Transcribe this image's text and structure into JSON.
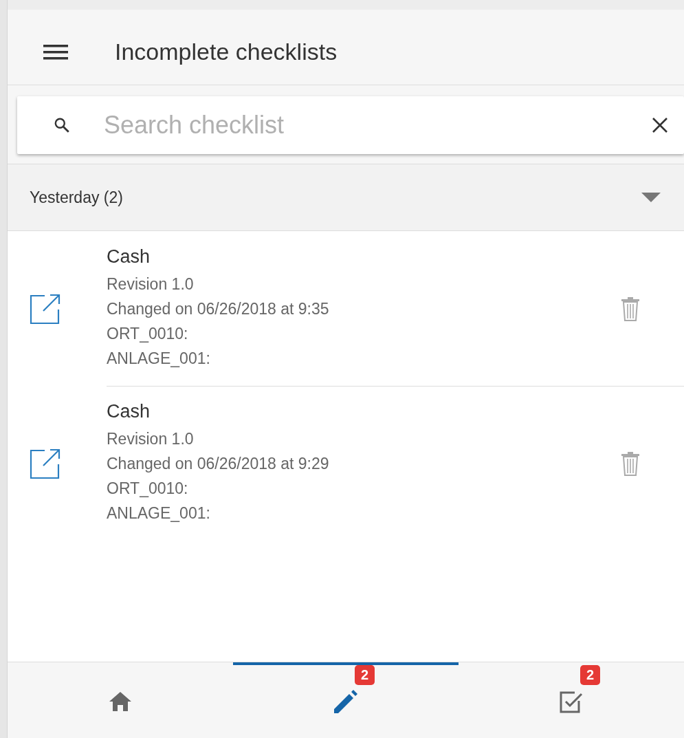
{
  "header": {
    "title": "Incomplete checklists"
  },
  "search": {
    "placeholder": "Search checklist"
  },
  "group": {
    "label": "Yesterday (2)",
    "expanded": true
  },
  "items": [
    {
      "title": "Cash",
      "lines": [
        "Revision 1.0",
        "Changed on 06/26/2018 at 9:35",
        "ORT_0010:",
        "ANLAGE_001:"
      ]
    },
    {
      "title": "Cash",
      "lines": [
        "Revision 1.0",
        "Changed on 06/26/2018 at 9:29",
        "ORT_0010:",
        "ANLAGE_001:"
      ]
    }
  ],
  "tabs": [
    {
      "kind": "home",
      "selected": false
    },
    {
      "kind": "edit",
      "selected": true,
      "badge": "2"
    },
    {
      "kind": "checklist",
      "selected": false,
      "badge": "2"
    }
  ]
}
